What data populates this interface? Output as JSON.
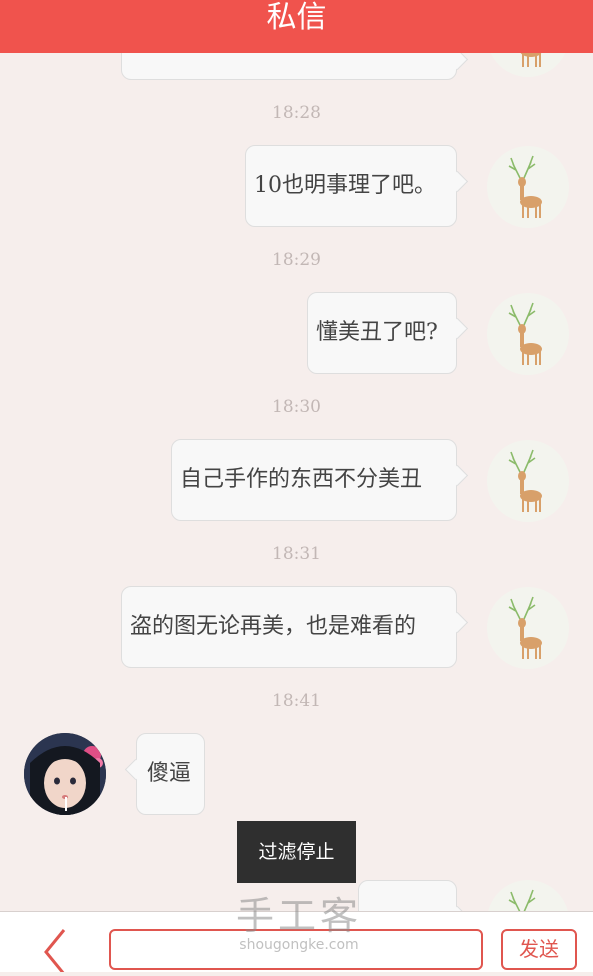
{
  "header": {
    "title": "私信"
  },
  "messages": [
    {
      "time": "18:28",
      "text": "10也明事理了吧。",
      "side": "right"
    },
    {
      "time": "18:29",
      "text": "懂美丑了吧?",
      "side": "right"
    },
    {
      "time": "18:30",
      "text": "自己手作的东西不分美丑",
      "side": "right"
    },
    {
      "time": "18:31",
      "text": "盗的图无论再美，也是难看的",
      "side": "right"
    },
    {
      "time": "18:41",
      "text": "傻逼",
      "side": "left"
    }
  ],
  "toast": "过滤停止",
  "watermark": {
    "brand": "手工客",
    "domain": "shougongke.com"
  },
  "footer": {
    "input_value": "",
    "send_label": "发送"
  },
  "colors": {
    "accent": "#f0534d",
    "background": "#f6eeec"
  },
  "icons": {
    "back": "chevron-left-icon"
  }
}
